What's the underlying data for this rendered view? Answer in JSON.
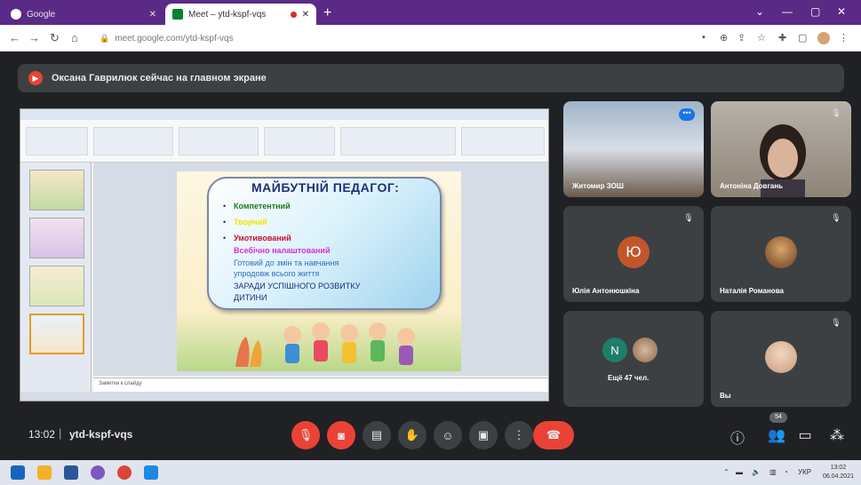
{
  "browser": {
    "tabs": [
      {
        "label": "Google"
      },
      {
        "label": "Meet – ytd-kspf-vqs"
      }
    ],
    "url": "meet.google.com/ytd-kspf-vqs"
  },
  "banner": {
    "text": "Оксана Гаврилюк сейчас на главном экране"
  },
  "slide": {
    "heading": "МАЙБУТНІЙ ПЕДАГОГ:",
    "lines": [
      {
        "text": "Компетентний",
        "color": "#1a7a1a"
      },
      {
        "text": "Творчий",
        "color": "#f2e500"
      },
      {
        "text": "Умотивований",
        "color": "#c8102e"
      },
      {
        "text": "Всебічно налаштований",
        "color": "#d62fd6"
      },
      {
        "text": "Готовий до змін та навчання",
        "color": "#2d6fc8"
      },
      {
        "text": "упродовж всього життя",
        "color": "#2d6fc8"
      },
      {
        "text": "ЗАРАДИ УСПІШНОГО РОЗВИТКУ",
        "color": "#1d2f7a"
      },
      {
        "text": "ДИТИНИ",
        "color": "#1d2f7a"
      }
    ],
    "notes": "Заметки к слайду"
  },
  "participants": [
    {
      "name": "Житомир ЗОШ",
      "initial": "",
      "type": "video-group"
    },
    {
      "name": "Антоніна Довгань",
      "initial": "",
      "type": "video-person"
    },
    {
      "name": "Юлія Антонюшкіна",
      "initial": "Ю",
      "type": "initial",
      "color": "#c1562b"
    },
    {
      "name": "Наталія Романова",
      "initial": "",
      "type": "photo",
      "color": "#7a4b2a"
    },
    {
      "name": "Ещё 47 чел.",
      "initial": "N",
      "type": "more",
      "color": "#1e7e6a"
    },
    {
      "name": "Вы",
      "initial": "",
      "type": "photo",
      "color": "#c89a7a"
    }
  ],
  "toolbar": {
    "time": "13:02",
    "meeting_code": "ytd-kspf-vqs",
    "participant_count": "54"
  },
  "taskbar": {
    "lang": "УКР",
    "time": "13:02",
    "date": "06.04.2021"
  },
  "colors": {
    "meet_bg": "#202124",
    "tile_bg": "#3c4043",
    "danger": "#ea4335",
    "browser_tab_bar": "#5b2a86"
  }
}
